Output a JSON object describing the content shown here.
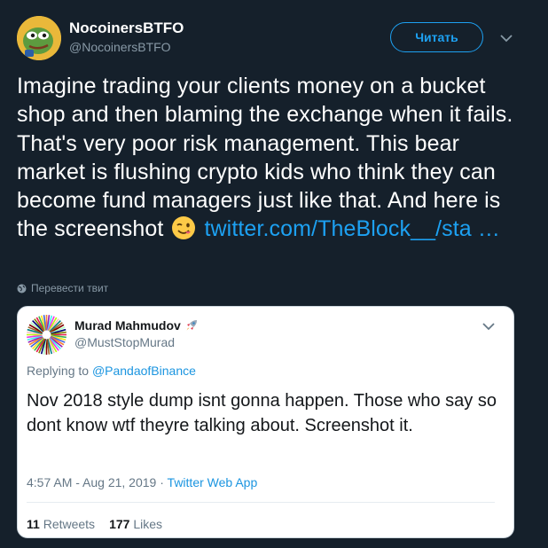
{
  "author": {
    "name": "NocoinersBTFO",
    "handle": "@NocoinersBTFO"
  },
  "follow_label": "Читать",
  "tweet": {
    "text": "Imagine trading your clients money on a bucket shop and then blaming the exchange when it fails. That's very poor risk management. This bear market is flushing crypto kids who think they can become fund managers just like that. And here is the screenshot",
    "emoji": "winking-face-emoji",
    "link": "twitter.com/TheBlock__/sta …"
  },
  "translate_label": "Перевести твит",
  "quoted": {
    "name": "Murad Mahmudov",
    "name_emoji": "rocket-emoji",
    "handle": "@MustStopMurad",
    "replying_prefix": "Replying to",
    "replying_to": "@PandaofBinance",
    "text": "Nov 2018 style dump isnt gonna happen. Those who say so dont know wtf theyre talking about. Screenshot it.",
    "timestamp": "4:57 AM - Aug 21, 2019",
    "separator": "·",
    "via": "Twitter Web App",
    "retweets_count": "11",
    "retweets_label": "Retweets",
    "likes_count": "177",
    "likes_label": "Likes"
  },
  "colors": {
    "background": "#15202b",
    "accent": "#1da1f2",
    "muted": "#8899a6",
    "card": "#ffffff"
  }
}
